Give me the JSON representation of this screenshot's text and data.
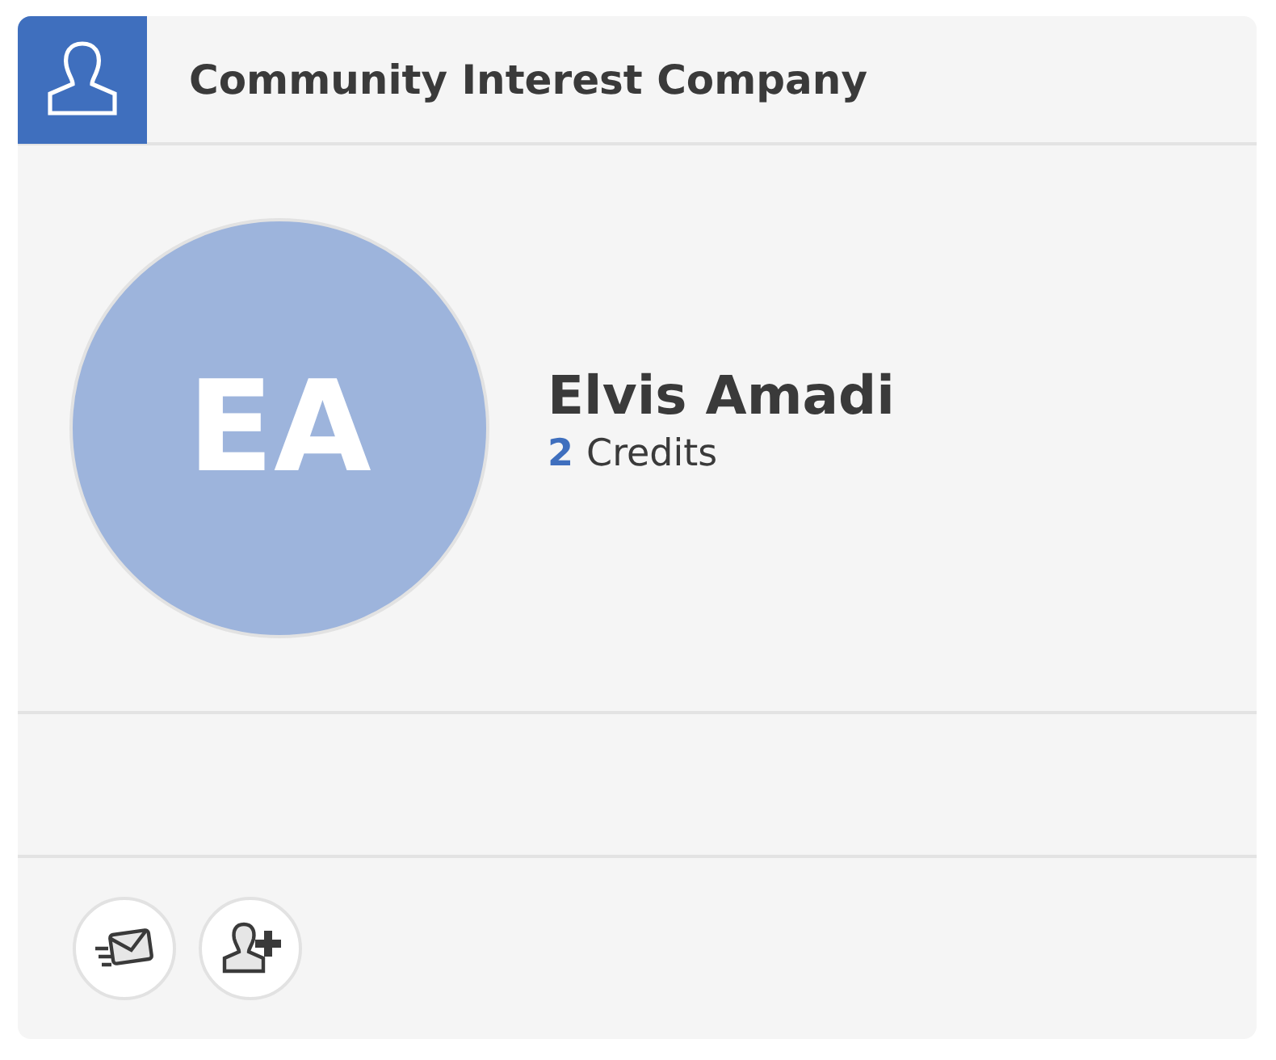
{
  "header": {
    "title": "Community Interest Company"
  },
  "profile": {
    "initials": "EA",
    "name": "Elvis Amadi",
    "credits_count": "2",
    "credits_label": "Credits"
  },
  "actions": [
    {
      "kind": "message"
    },
    {
      "kind": "add-contact"
    }
  ]
}
